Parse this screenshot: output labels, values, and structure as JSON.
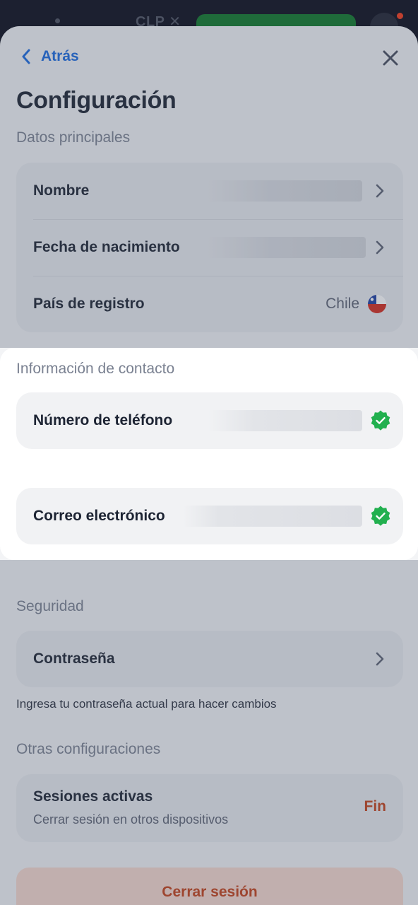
{
  "background_bar": {
    "currency": "CLP ✕"
  },
  "nav": {
    "back_label": "Atrás"
  },
  "page_title": "Configuración",
  "main_data": {
    "title": "Datos principales",
    "rows": [
      {
        "label": "Nombre"
      },
      {
        "label": "Fecha de nacimiento"
      },
      {
        "label": "País de registro",
        "value": "Chile",
        "flag": "chile-flag"
      }
    ]
  },
  "contact": {
    "title": "Información de contacto",
    "phone_label": "Número de teléfono",
    "email_label": "Correo electrónico",
    "verified_icon": "verified-check-icon",
    "verified_color": "#22b04f"
  },
  "security": {
    "title": "Seguridad",
    "password_label": "Contraseña",
    "hint": "Ingresa tu contraseña actual para hacer cambios"
  },
  "other": {
    "title": "Otras configuraciones",
    "sessions_title": "Sesiones activas",
    "sessions_sub": "Cerrar sesión en otros dispositivos",
    "sessions_action": "Fin"
  },
  "logout_label": "Cerrar sesión",
  "colors": {
    "accent": "#1a6ae0",
    "danger": "#c4421a",
    "success": "#22b04f"
  }
}
